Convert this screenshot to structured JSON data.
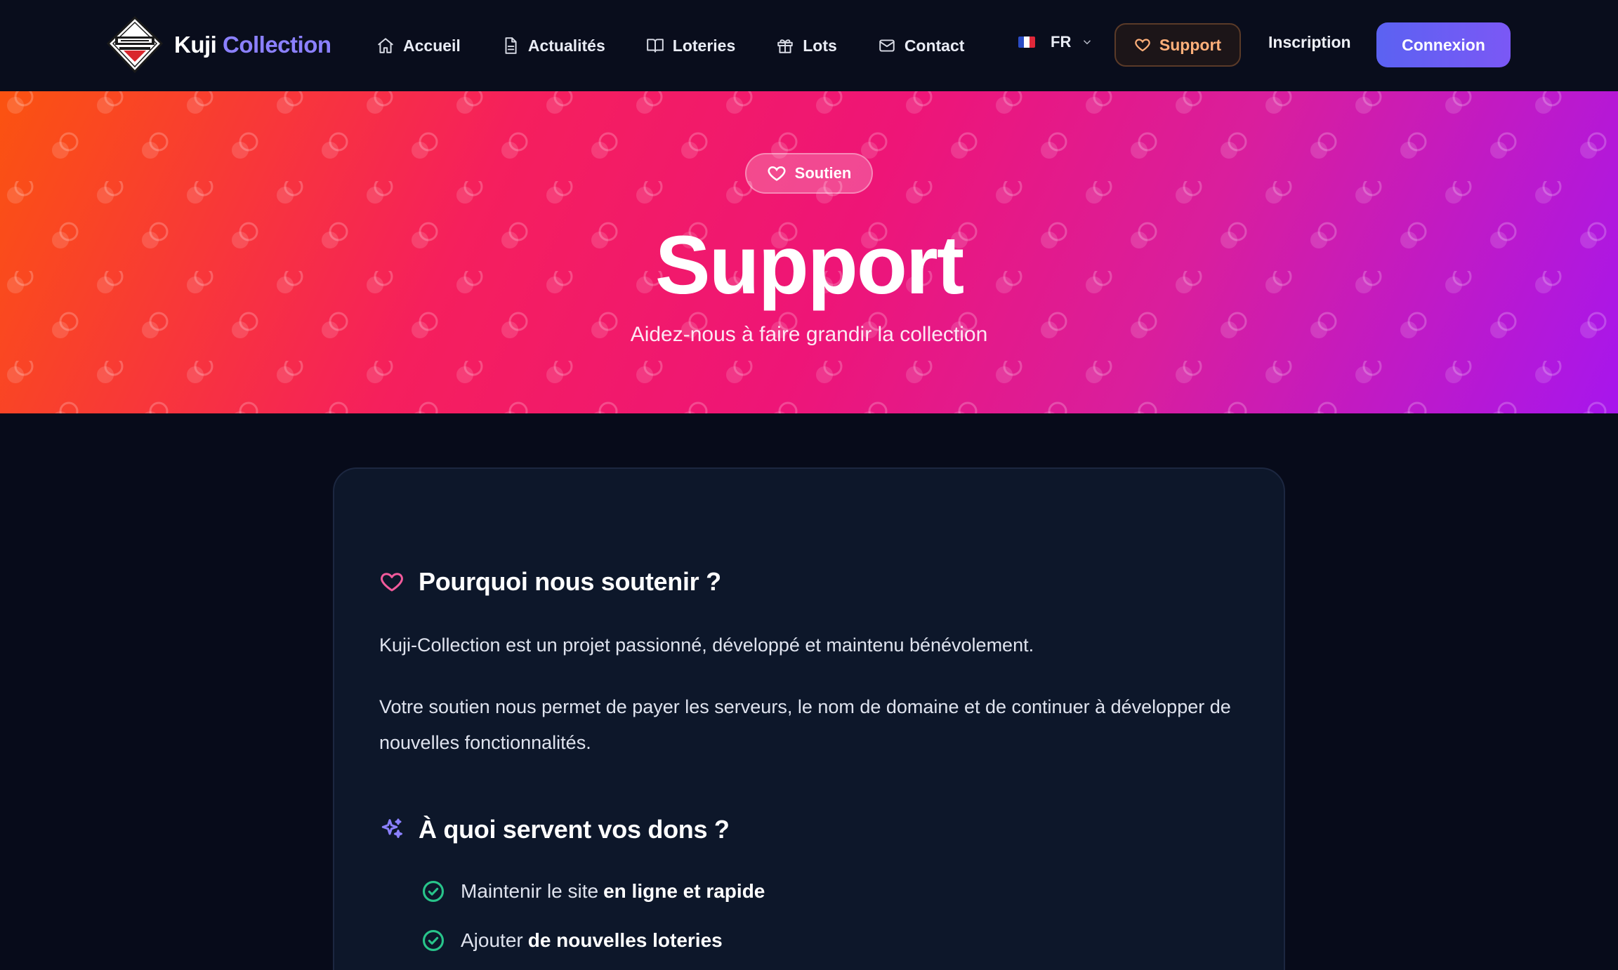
{
  "colors": {
    "page_bg": "#070b1a",
    "nav_bg": "#090d1c",
    "brand_accent": "#8b80ff",
    "support_accent": "#ffb07a",
    "login_button": "#6a5df4",
    "hero_gradient": [
      "#fb5310",
      "#f51f5d",
      "#ee1577",
      "#d91e9d",
      "#a716ed"
    ],
    "card_bg": "#0d172a",
    "check_green": "#28c48a",
    "heart_pink": "#f25a9b"
  },
  "navbar": {
    "brand_first": "Kuji",
    "brand_second": "Collection",
    "links": [
      {
        "label": "Accueil",
        "icon": "home-icon"
      },
      {
        "label": "Actualités",
        "icon": "document-icon"
      },
      {
        "label": "Loteries",
        "icon": "book-open-icon"
      },
      {
        "label": "Lots",
        "icon": "gift-icon"
      },
      {
        "label": "Contact",
        "icon": "mail-icon"
      }
    ],
    "language": "FR",
    "support_label": "Support",
    "signup_label": "Inscription",
    "login_label": "Connexion"
  },
  "hero": {
    "badge": "Soutien",
    "title": "Support",
    "subtitle": "Aidez-nous à faire grandir la collection"
  },
  "content": {
    "why_title": "Pourquoi nous soutenir ?",
    "why_paragraph_1": "Kuji-Collection est un projet passionné, développé et maintenu bénévolement.",
    "why_paragraph_2": "Votre soutien nous permet de payer les serveurs, le nom de domaine et de continuer à développer de nouvelles fonctionnalités.",
    "use_title": "À quoi servent vos dons ?",
    "uses": [
      {
        "text": "Maintenir le site",
        "bold": "en ligne et rapide"
      },
      {
        "text": "Ajouter",
        "bold": "de nouvelles loteries"
      }
    ]
  }
}
